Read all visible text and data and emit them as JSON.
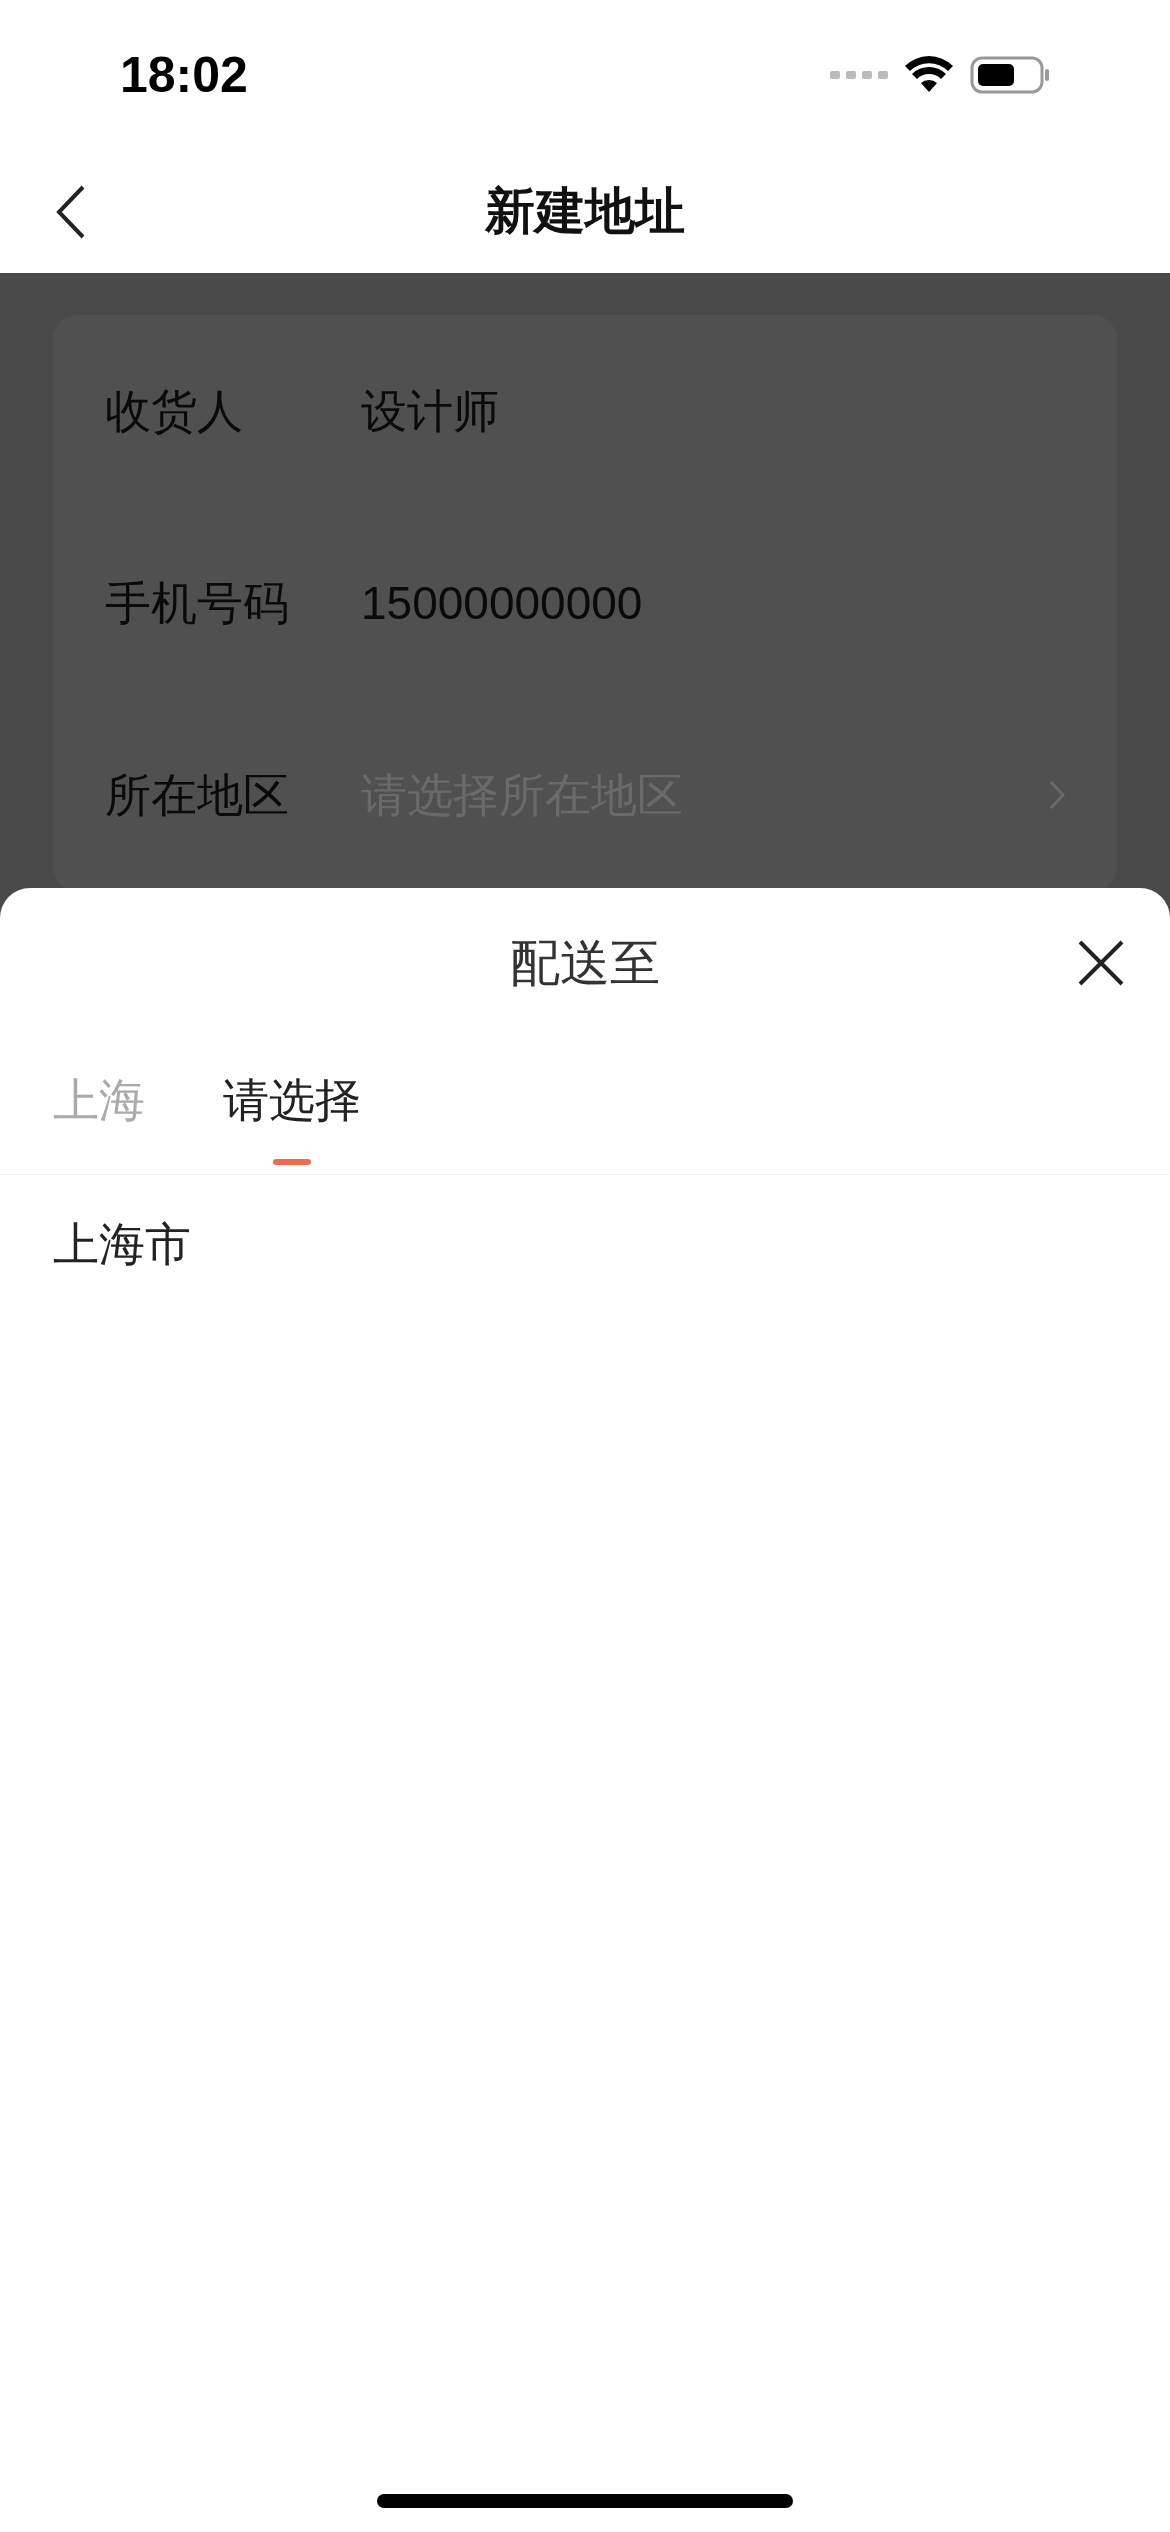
{
  "status_bar": {
    "time": "18:02"
  },
  "nav": {
    "title": "新建地址"
  },
  "form": [
    {
      "label": "收货人",
      "value": "设计师"
    },
    {
      "label": "手机号码",
      "value": "15000000000"
    },
    {
      "label": "所在地区",
      "placeholder": "请选择所在地区",
      "kind": "picker"
    }
  ],
  "sheet": {
    "title": "配送至",
    "tabs": [
      {
        "label": "上海",
        "selected": false
      },
      {
        "label": "请选择",
        "selected": true
      }
    ],
    "items": [
      {
        "label": "上海市"
      }
    ]
  }
}
